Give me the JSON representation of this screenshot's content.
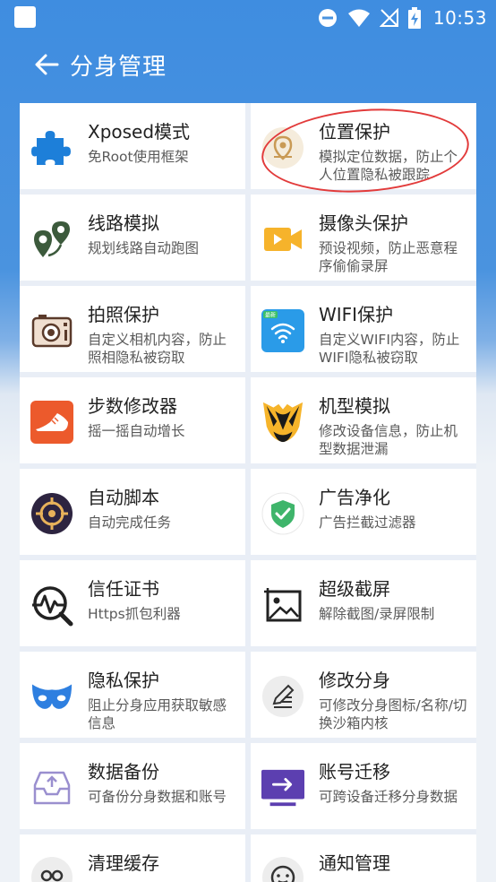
{
  "status": {
    "time": "10:53"
  },
  "appbar": {
    "title": "分身管理"
  },
  "items": [
    {
      "name": "Xposed模式",
      "desc": "免Root使用框架",
      "icon": "puzzle-icon"
    },
    {
      "name": "位置保护",
      "desc": "模拟定位数据，防止个人位置隐私被跟踪",
      "icon": "location-pin-icon"
    },
    {
      "name": "线路模拟",
      "desc": "规划线路自动跑图",
      "icon": "route-pins-icon"
    },
    {
      "name": "摄像头保护",
      "desc": "预设视频，防止恶意程序偷偷录屏",
      "icon": "video-camera-icon"
    },
    {
      "name": "拍照保护",
      "desc": "自定义相机内容，防止照相隐私被窃取",
      "icon": "camera-icon"
    },
    {
      "name": "WIFI保护",
      "desc": "自定义WIFI内容，防止WIFI隐私被窃取",
      "icon": "wifi-icon",
      "badge": "最新"
    },
    {
      "name": "步数修改器",
      "desc": "摇一摇自动增长",
      "icon": "shoe-icon"
    },
    {
      "name": "机型模拟",
      "desc": "修改设备信息，防止机型数据泄漏",
      "icon": "mask-face-icon"
    },
    {
      "name": "自动脚本",
      "desc": "自动完成任务",
      "icon": "target-icon"
    },
    {
      "name": "广告净化",
      "desc": "广告拦截过滤器",
      "icon": "shield-check-icon"
    },
    {
      "name": "信任证书",
      "desc": "Https抓包利器",
      "icon": "pulse-search-icon"
    },
    {
      "name": "超级截屏",
      "desc": "解除截图/录屏限制",
      "icon": "image-frame-icon"
    },
    {
      "name": "隐私保护",
      "desc": "阻止分身应用获取敏感信息",
      "icon": "eye-mask-icon"
    },
    {
      "name": "修改分身",
      "desc": "可修改分身图标/名称/切换沙箱内核",
      "icon": "edit-icon"
    },
    {
      "name": "数据备份",
      "desc": "可备份分身数据和账号",
      "icon": "inbox-icon"
    },
    {
      "name": "账号迁移",
      "desc": "可跨设备迁移分身数据",
      "icon": "transfer-icon"
    },
    {
      "name": "清理缓存",
      "desc": "",
      "icon": "broom-icon"
    },
    {
      "name": "通知管理",
      "desc": "",
      "icon": "chat-icon"
    }
  ]
}
